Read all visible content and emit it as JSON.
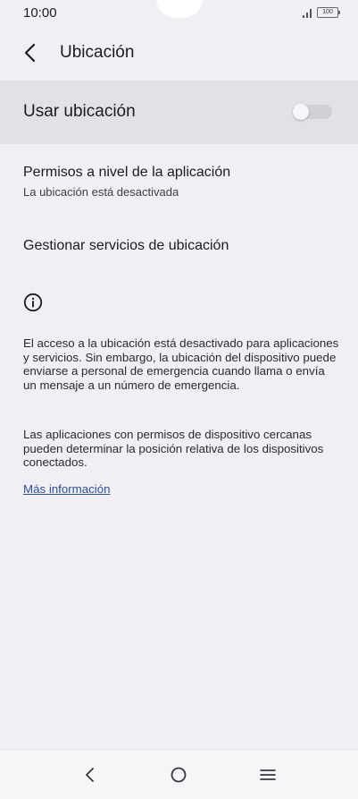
{
  "status_bar": {
    "time": "10:00",
    "battery": "100"
  },
  "header": {
    "title": "Ubicación"
  },
  "main_toggle": {
    "label": "Usar ubicación",
    "enabled": false
  },
  "items": [
    {
      "title": "Permisos a nivel de la aplicación",
      "summary": "La ubicación está desactivada"
    },
    {
      "title": "Gestionar servicios de ubicación"
    }
  ],
  "info": {
    "paragraph1": "El acceso a la ubicación está desactivado para aplicaciones y servicios. Sin embargo, la ubicación del dispositivo puede enviarse a personal de emergencia cuando llama o envía un mensaje a un número de emergencia.",
    "paragraph2": "Las aplicaciones con permisos de dispositivo cercanas pueden determinar la posición relativa de los dispositivos conectados.",
    "link": "Más información"
  },
  "icons": {
    "back": "chevron-left-icon",
    "info": "info-circle-icon",
    "nav_back": "nav-back-icon",
    "nav_home": "nav-home-icon",
    "nav_recents": "nav-menu-icon"
  },
  "colors": {
    "background": "#f1eff4",
    "highlight_row": "#e3e1e6",
    "link": "#2c4f94"
  }
}
